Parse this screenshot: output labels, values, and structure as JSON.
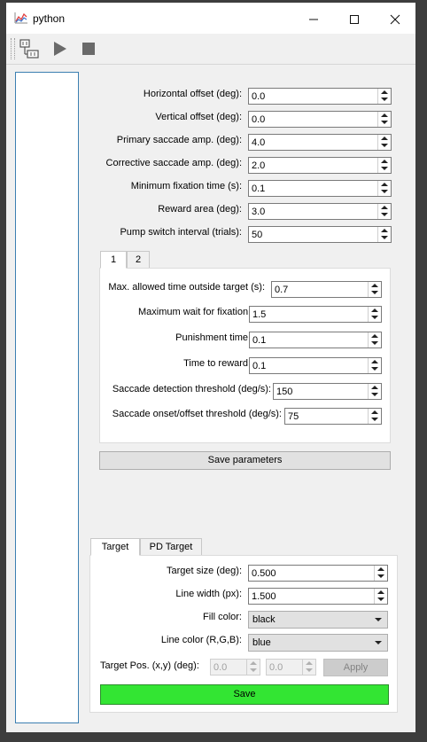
{
  "window": {
    "title": "python"
  },
  "toolbar": {
    "buttons": [
      "plugin-icon",
      "play-icon",
      "stop-icon"
    ]
  },
  "params": [
    {
      "label": "Horizontal offset (deg):",
      "value": "0.0"
    },
    {
      "label": "Vertical offset (deg):",
      "value": "0.0"
    },
    {
      "label": "Primary saccade amp. (deg):",
      "value": "4.0"
    },
    {
      "label": "Corrective saccade amp. (deg):",
      "value": "2.0"
    },
    {
      "label": "Minimum fixation time (s):",
      "value": "0.1"
    },
    {
      "label": "Reward area (deg):",
      "value": "3.0"
    },
    {
      "label": "Pump switch interval (trials):",
      "value": "50"
    }
  ],
  "param_tabs": [
    "1",
    "2"
  ],
  "tab1_params": [
    {
      "label": "Max. allowed time outside target (s):",
      "value": "0.7"
    },
    {
      "label": "Maximum wait for fixation (s):",
      "value": "1.5"
    },
    {
      "label": "Punishment time (s):",
      "value": "0.1"
    },
    {
      "label": "Time to reward (s):",
      "value": "0.1"
    },
    {
      "label": "Saccade detection threshold (deg/s):",
      "value": "150"
    },
    {
      "label": "Saccade onset/offset threshold (deg/s):",
      "value": "75"
    }
  ],
  "save_params_label": "Save parameters",
  "target_tabs": [
    "Target",
    "PD Target"
  ],
  "target": {
    "size_label": "Target size (deg):",
    "size_value": "0.500",
    "line_width_label": "Line width (px):",
    "line_width_value": "1.500",
    "fill_color_label": "Fill color:",
    "fill_color_value": "black",
    "line_color_label": "Line color (R,G,B):",
    "line_color_value": "blue",
    "pos_label": "Target Pos. (x,y) (deg):",
    "pos_x": "0.0",
    "pos_y": "0.0",
    "apply_label": "Apply",
    "save_label": "Save"
  },
  "colors": {
    "save_button": "#33e533",
    "selection_border": "#3c7fb1"
  }
}
